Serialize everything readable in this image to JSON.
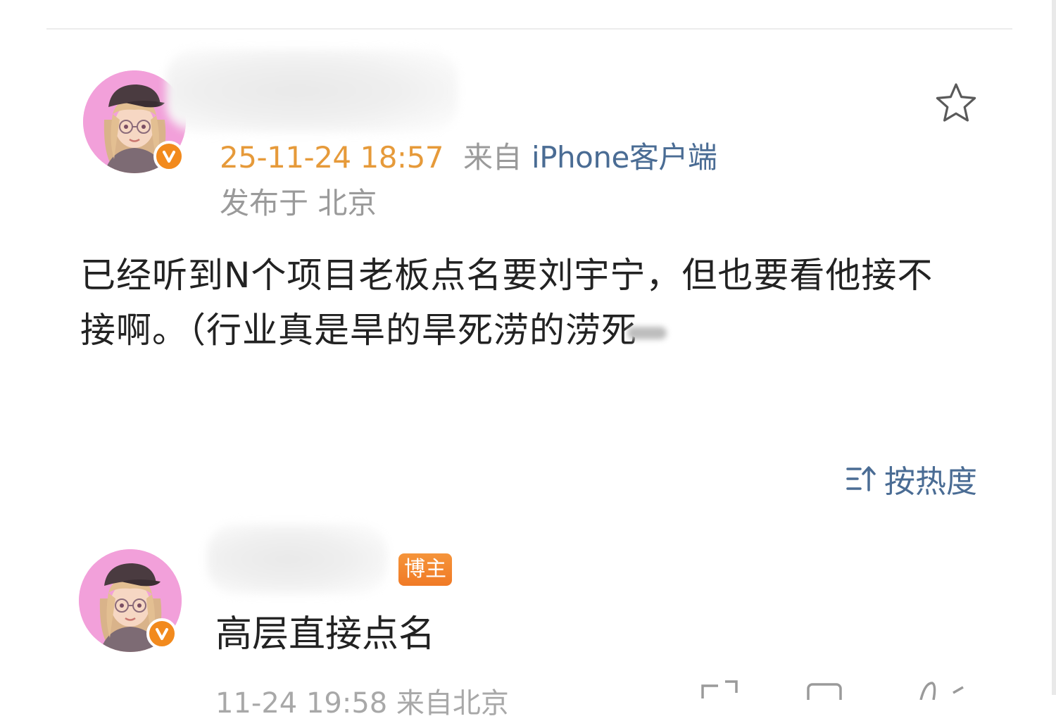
{
  "post": {
    "timestamp": "25-11-24 18:57",
    "source_prefix": "来自",
    "source_client": "iPhone客户端",
    "location": "发布于 北京",
    "body": "已经听到N个项目老板点名要刘宇宁，但也要看他接不接啊。（行业真是旱的旱死涝的涝死"
  },
  "icons": {
    "favorite": "star-outline-icon",
    "verified": "verified-v-icon",
    "sort": "sort-icon"
  },
  "comments": {
    "sort_label": "按热度",
    "items": [
      {
        "badge": "博主",
        "text": "高层直接点名",
        "meta_partial": "11-24 19:58 来自北京"
      }
    ]
  },
  "colors": {
    "timestamp": "#e69a3a",
    "link_blue": "#4a6c94",
    "muted": "#9a9a9a",
    "badge_orange": "#f07a26",
    "verified_orange": "#f28a1d"
  }
}
